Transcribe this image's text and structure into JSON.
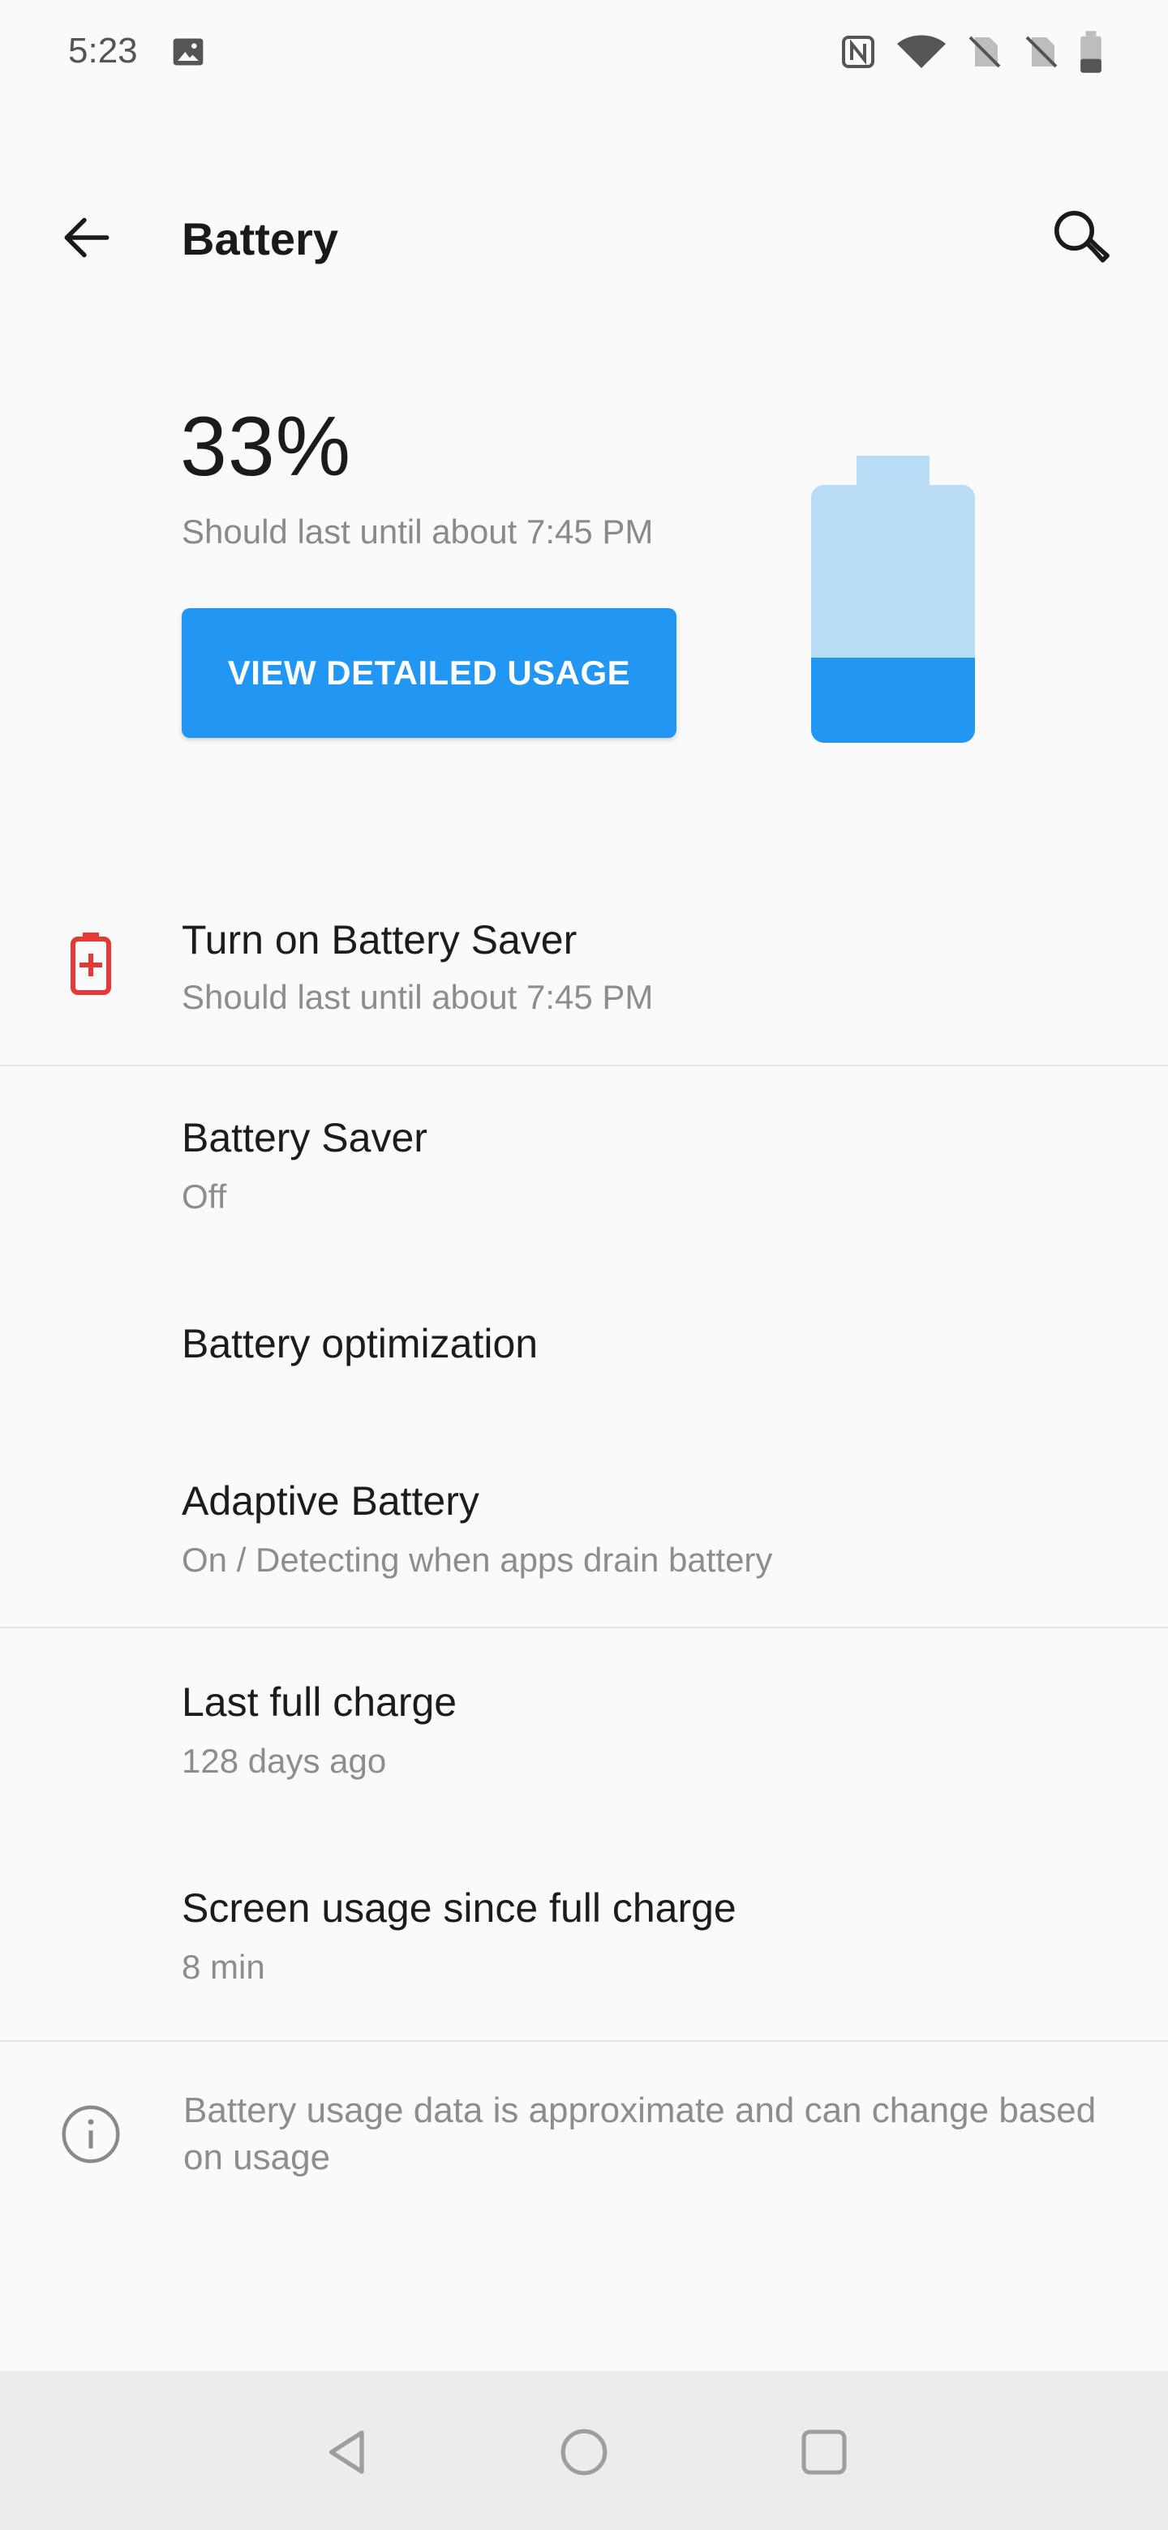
{
  "status_bar": {
    "time": "5:23"
  },
  "toolbar": {
    "title": "Battery"
  },
  "summary": {
    "percent": "33%",
    "level": 0.33,
    "estimate": "Should last until about 7:45 PM",
    "button_label": "VIEW DETAILED USAGE"
  },
  "rows": {
    "saver_suggestion": {
      "title": "Turn on Battery Saver",
      "subtitle": "Should last until about 7:45 PM"
    },
    "battery_saver": {
      "title": "Battery Saver",
      "subtitle": "Off"
    },
    "optimization": {
      "title": "Battery optimization"
    },
    "adaptive": {
      "title": "Adaptive Battery",
      "subtitle": "On / Detecting when apps drain battery"
    },
    "last_full_charge": {
      "title": "Last full charge",
      "subtitle": "128 days ago"
    },
    "screen_usage": {
      "title": "Screen usage since full charge",
      "subtitle": "8 min"
    }
  },
  "footer": {
    "info_text": "Battery usage data is approximate and can change based on usage"
  },
  "colors": {
    "accent": "#2196f3",
    "accent_light": "#b9dcf7",
    "warning": "#e53935"
  }
}
